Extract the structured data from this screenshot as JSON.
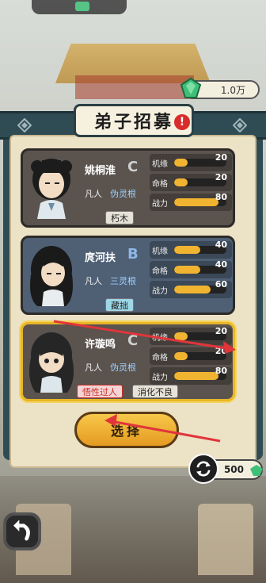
{
  "currency": {
    "gems": "1.0万"
  },
  "panel": {
    "title": "弟子招募",
    "alert": "!"
  },
  "disciples": [
    {
      "name": "姚桐淮",
      "grade": "C",
      "rank": "凡人",
      "root": "伪灵根",
      "stats": [
        {
          "label": "机缘",
          "value": 20,
          "pct": 0.25
        },
        {
          "label": "命格",
          "value": 20,
          "pct": 0.25
        },
        {
          "label": "战力",
          "value": 80,
          "pct": 0.85
        }
      ],
      "tags": [
        "朽木"
      ]
    },
    {
      "name": "庹河扶",
      "grade": "B",
      "rank": "凡人",
      "root": "三灵根",
      "stats": [
        {
          "label": "机缘",
          "value": 40,
          "pct": 0.5
        },
        {
          "label": "命格",
          "value": 40,
          "pct": 0.5
        },
        {
          "label": "战力",
          "value": 60,
          "pct": 0.7
        }
      ],
      "tags": [
        "藏拙"
      ]
    },
    {
      "name": "许璇鸣",
      "grade": "C",
      "rank": "凡人",
      "root": "伪灵根",
      "stats": [
        {
          "label": "机缘",
          "value": 20,
          "pct": 0.25
        },
        {
          "label": "命格",
          "value": 20,
          "pct": 0.25
        },
        {
          "label": "战力",
          "value": 80,
          "pct": 0.85
        }
      ],
      "tags": [
        "悟性过人",
        "消化不良"
      ]
    }
  ],
  "select_button": {
    "label": "选择"
  },
  "refresh": {
    "cost": "500"
  },
  "colors": {
    "gold": "#f0b431",
    "panel": "#2f4c54",
    "selected": "#e8b627",
    "arrow": "#e0353b"
  }
}
